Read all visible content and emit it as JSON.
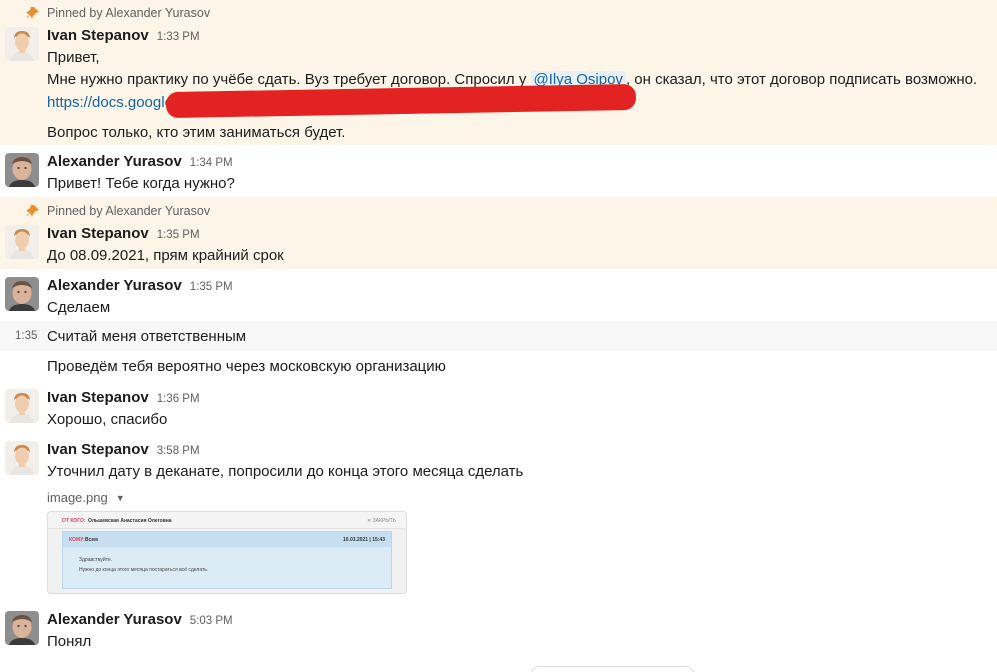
{
  "messages": [
    {
      "pinned_text": "Pinned by Alexander Yurasov",
      "author": "Ivan Stepanov",
      "time": "1:33 PM",
      "line1": "Привет,",
      "line2_before": "Мне нужно практику по учёбе сдать. Вуз требует договор. Спросил у ",
      "mention": "@Ilya Osipov",
      "line2_after": ", он сказал, что этот договор подписать возможно.",
      "link": "https://docs.google",
      "line4": "Вопрос только, кто этим заниматься будет."
    },
    {
      "author": "Alexander Yurasov",
      "time": "1:34 PM",
      "text": "Привет! Тебе когда нужно?"
    },
    {
      "pinned_text": "Pinned by Alexander Yurasov",
      "author": "Ivan Stepanov",
      "time": "1:35 PM",
      "text": "До 08.09.2021, прям крайний срок"
    },
    {
      "author": "Alexander Yurasov",
      "time": "1:35 PM",
      "text": "Сделаем",
      "followups": [
        {
          "time": "1:35",
          "text": "Считай меня ответственным"
        },
        {
          "text": "Проведём тебя вероятно через московскую организацию"
        }
      ]
    },
    {
      "author": "Ivan Stepanov",
      "time": "1:36 PM",
      "text": "Хорошо, спасибо"
    },
    {
      "author": "Ivan Stepanov",
      "time": "3:58 PM",
      "text": "Уточнил дату в деканате, попросили до конца этого месяца сделать",
      "file_name": "image.png",
      "attachment": {
        "from_label": "ОТ КОГО:",
        "from_name": "Ольшевская Анастасия Олеговна",
        "close_label": "✕ ЗАКРЫТЬ",
        "to_label": "КОМУ:",
        "to_name": "Всем",
        "date": "10.03.2021 | 15:43",
        "line1": "Здравствуйте.",
        "line2": "Нужно до конца этого месяца постараться всё сделать."
      }
    },
    {
      "author": "Alexander Yurasov",
      "time": "5:03 PM",
      "text": "Понял"
    }
  ],
  "colors": {
    "pinned_background": "#fdf5e8",
    "link": "#1264a3",
    "redaction": "#e32322"
  }
}
